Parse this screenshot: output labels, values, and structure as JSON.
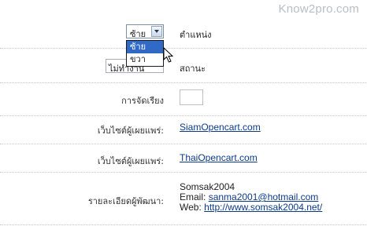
{
  "watermark": "Know2pro.com",
  "position_field": {
    "selected": "ซ้าย",
    "options": [
      "ซ้าย",
      "ขวา"
    ],
    "highlighted_option": "ซ้าย",
    "label": "ตำแหน่ง"
  },
  "status_field": {
    "selected": "ไม่ทำงาน",
    "label": "สถานะ"
  },
  "sort_field": {
    "label": "การจัดเรียง",
    "value": ""
  },
  "publisher_1": {
    "label": "เว็บไซต์ผู้เผยแพร่:",
    "link": "SiamOpencart.com"
  },
  "publisher_2": {
    "label": "เว็บไซต์ผู้เผยแพร่:",
    "link": "ThaiOpencart.com"
  },
  "developer": {
    "label": "รายละเอียดผู้พัฒนา:",
    "name": "Somsak2004",
    "email_label": "Email:",
    "email": "sanma2001@hotmail.com",
    "web_label": "Web:",
    "web": "http://www.somsak2004.net/"
  },
  "colors": {
    "link": "#0c3a8a",
    "highlight": "#3169c6",
    "watermark": "#b9bec4"
  }
}
